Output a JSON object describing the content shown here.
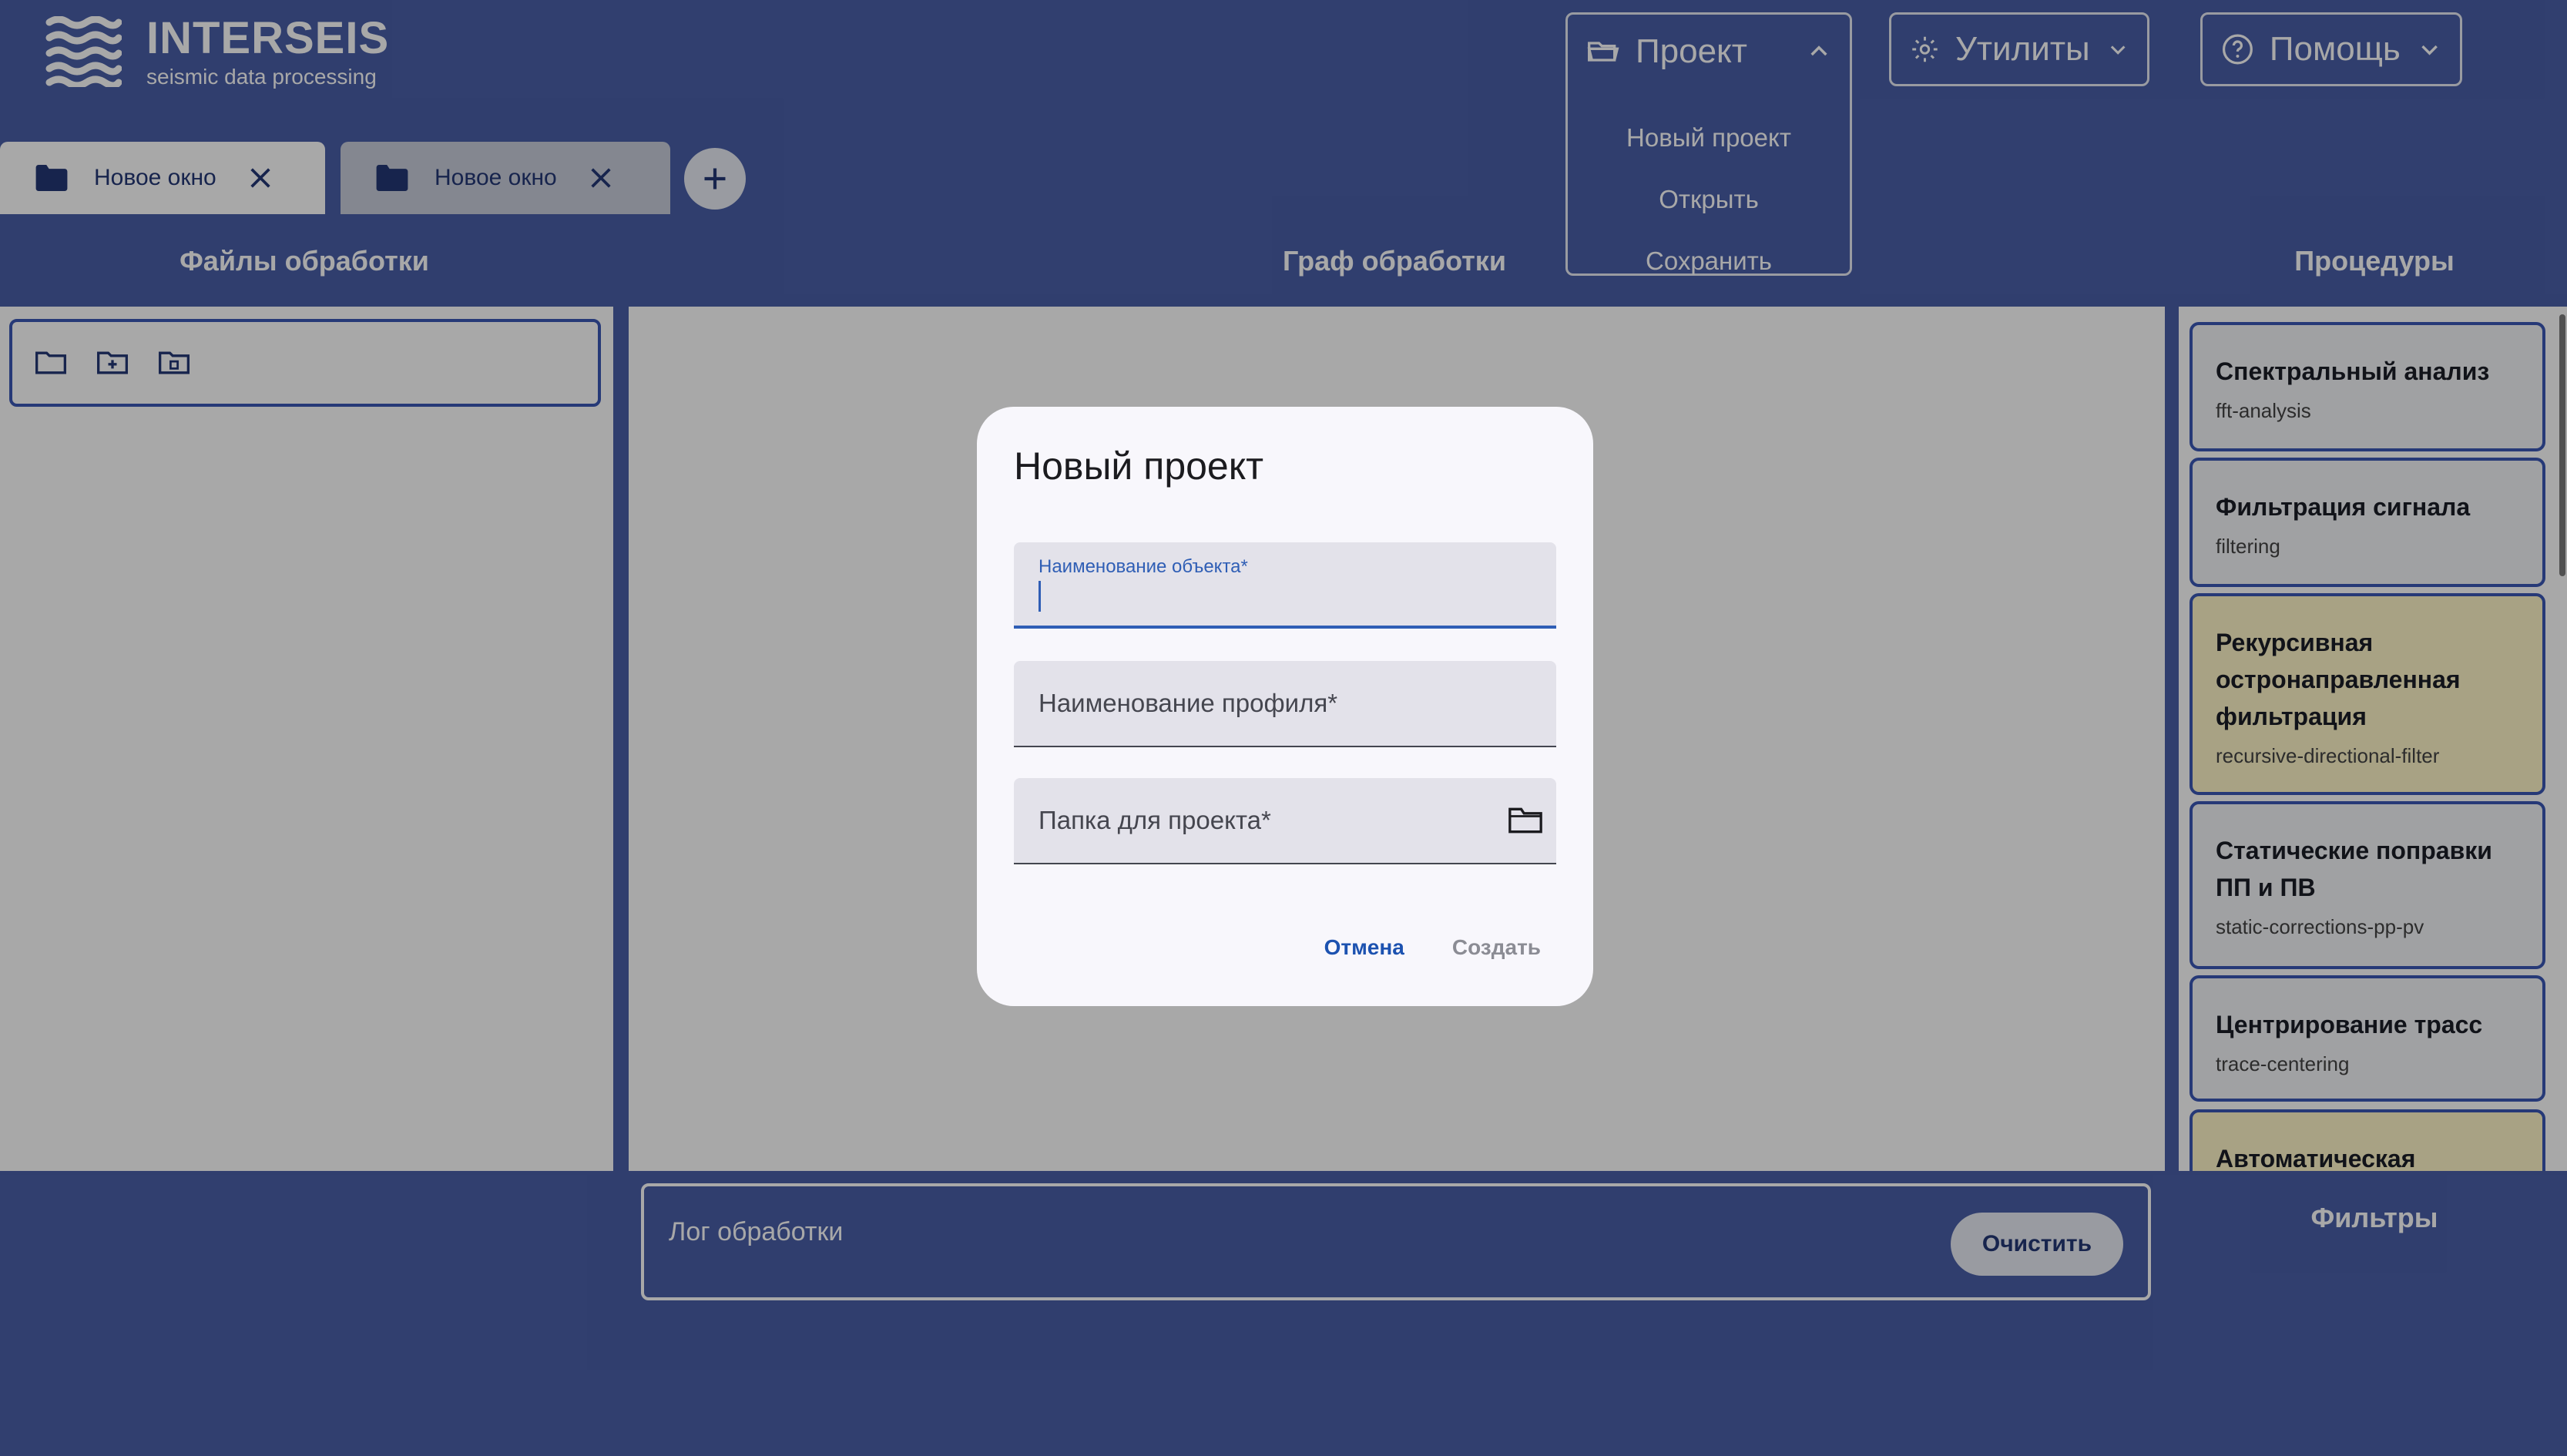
{
  "brand": {
    "title": "INTERSEIS",
    "subtitle": "seismic data processing"
  },
  "menus": {
    "project": {
      "label": "Проект",
      "items": [
        "Новый проект",
        "Открыть",
        "Сохранить"
      ]
    },
    "utils": {
      "label": "Утилиты"
    },
    "help": {
      "label": "Помощь"
    }
  },
  "tabs": [
    {
      "label": "Новое окно"
    },
    {
      "label": "Новое окно"
    }
  ],
  "sections": {
    "files": "Файлы обработки",
    "graph": "Граф обработки",
    "procedures": "Процедуры",
    "filters": "Фильтры"
  },
  "procedures": [
    {
      "name": "Спектральный анализ",
      "id": "fft-analysis",
      "highlight": false
    },
    {
      "name": "Фильтрация сигнала",
      "id": "filtering",
      "highlight": false
    },
    {
      "name": "Рекурсивная остронаправленная фильтрация",
      "id": "recursive-directional-filter",
      "highlight": true
    },
    {
      "name": "Статические поправки ПП и ПВ",
      "id": "static-corrections-pp-pv",
      "highlight": false
    },
    {
      "name": "Центрирование трасс",
      "id": "trace-centering",
      "highlight": false
    },
    {
      "name": "Автоматическая",
      "id": "",
      "highlight": true
    }
  ],
  "log": {
    "title": "Лог обработки",
    "clear_label": "Очистить"
  },
  "dialog": {
    "title": "Новый проект",
    "fields": {
      "object_label": "Наименование объекта*",
      "object_value": "",
      "profile_placeholder": "Наименование профиля*",
      "folder_placeholder": "Папка для проекта*"
    },
    "cancel_label": "Отмена",
    "create_label": "Создать"
  },
  "colors": {
    "primary": "#243876",
    "accent": "#2f5eb5",
    "highlight_card": "#fff6c8"
  },
  "icons": [
    "logo-waves-icon",
    "folder-open-icon",
    "gear-icon",
    "help-circle-icon",
    "chevron-up-icon",
    "chevron-down-icon",
    "folder-icon",
    "close-icon",
    "plus-icon",
    "folder-add-icon",
    "folder-delete-icon"
  ]
}
